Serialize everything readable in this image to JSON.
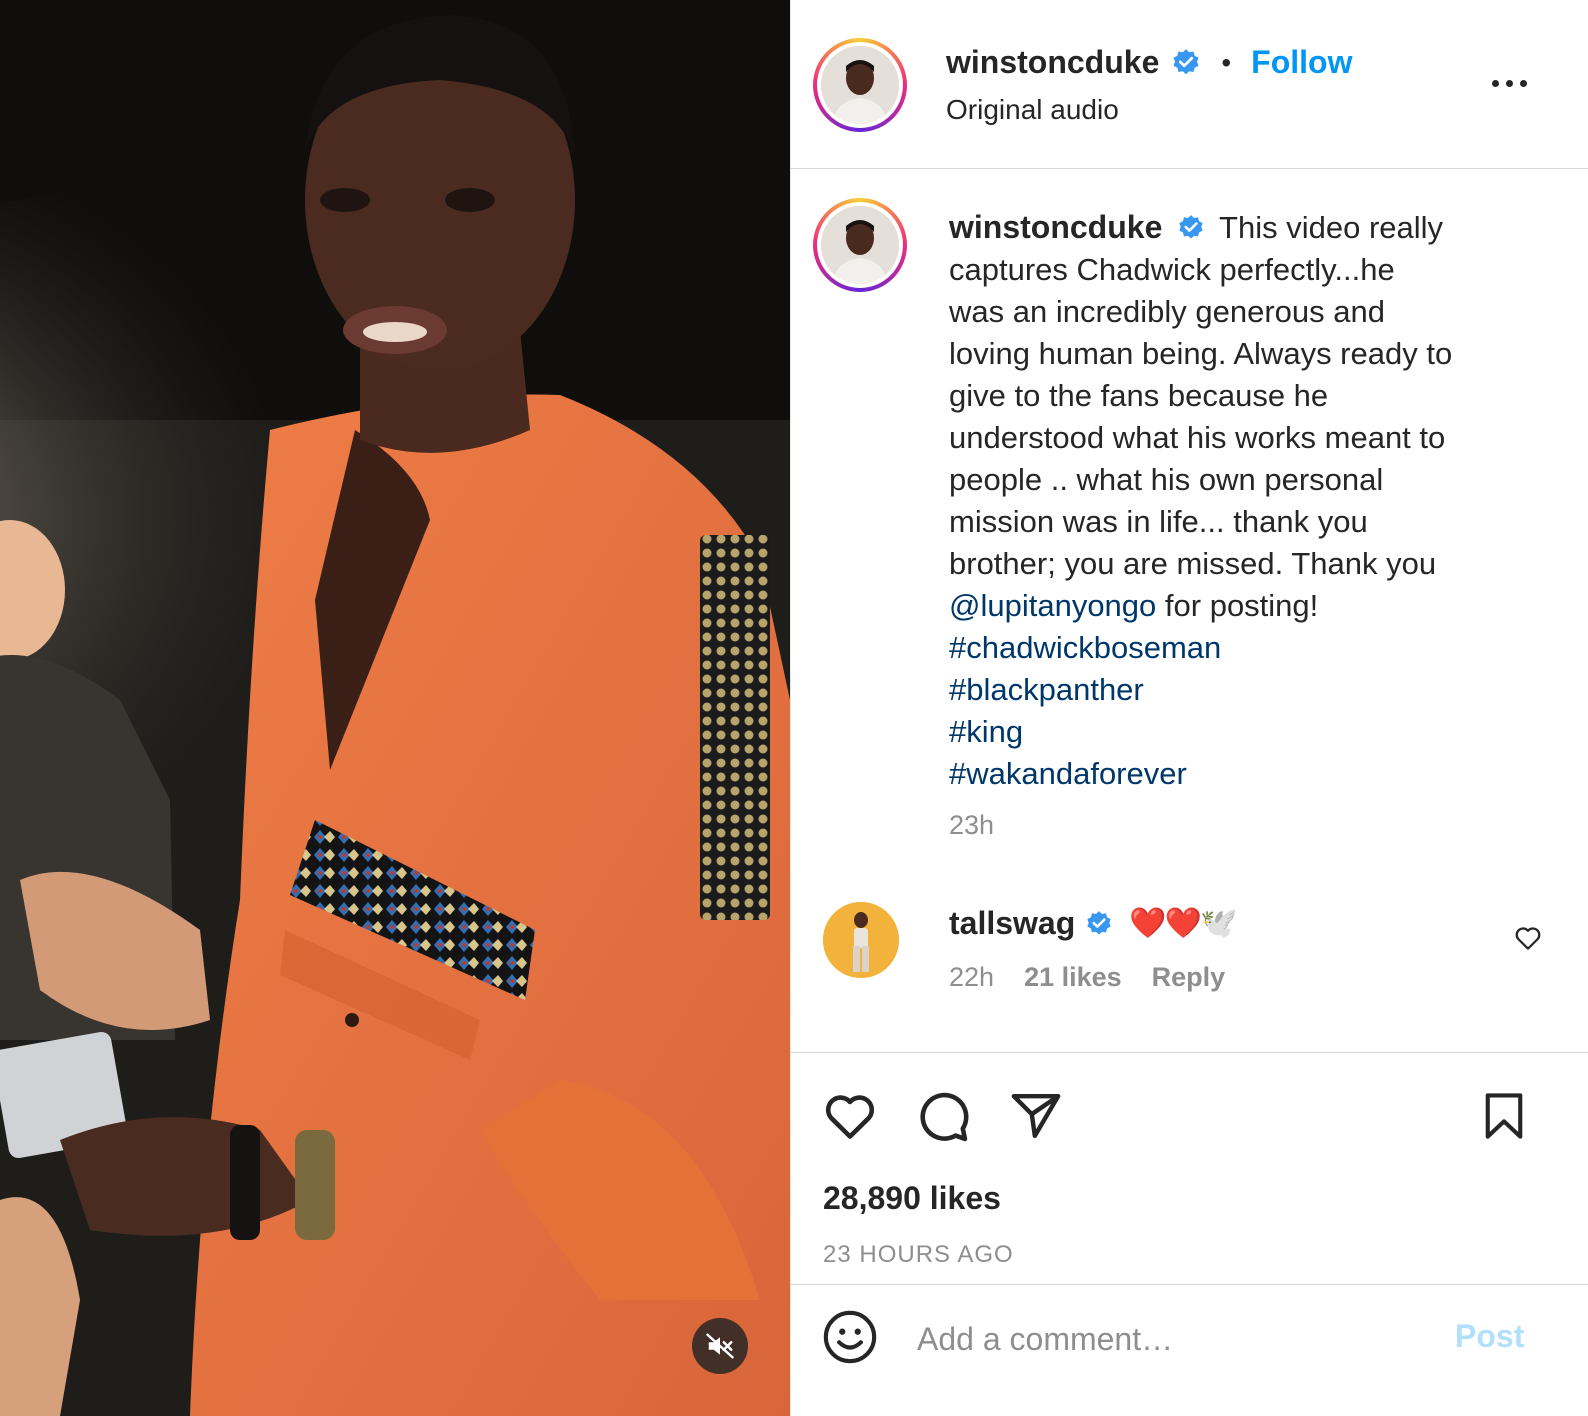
{
  "post": {
    "media": {
      "mute_icon": "speaker-muted-icon"
    },
    "header": {
      "username": "winstoncduke",
      "separator": "•",
      "follow_label": "Follow",
      "subtitle": "Original audio",
      "more_icon": "more-horizontal-icon"
    },
    "caption": {
      "username": "winstoncduke",
      "lines": [
        "This video really",
        "captures Chadwick perfectly...he",
        "was an incredibly generous and",
        "loving human being. Always ready to",
        "give to the fans because he",
        "understood what his works meant to",
        "people .. what his own personal",
        "mission was in life... thank you",
        "brother; you are missed. Thank you"
      ],
      "mention": "@lupitanyongo",
      "mention_suffix": " for posting!",
      "hashtags": [
        "#chadwickboseman",
        "#blackpanther",
        "#king",
        "#wakandaforever"
      ],
      "time": "23h"
    },
    "comment": {
      "username": "tallswag",
      "text": "❤️❤️🕊️",
      "time": "22h",
      "likes": "21 likes",
      "reply_label": "Reply"
    },
    "actions": {
      "like_icon": "heart-icon",
      "comment_icon": "comment-bubble-icon",
      "share_icon": "send-paper-plane-icon",
      "save_icon": "bookmark-icon"
    },
    "likes_count": "28,890 likes",
    "posted_ago": "23 HOURS AGO",
    "add_comment": {
      "placeholder": "Add a comment…",
      "post_label": "Post",
      "emoji_icon": "smiley-face-icon"
    }
  },
  "colors": {
    "follow_blue": "#0095f6",
    "link_navy": "#00376b",
    "verified_blue": "#3897f0",
    "muted_gray": "#8e8e8e",
    "post_disabled": "#b2dffc",
    "shirt_orange": "#e8733f"
  }
}
